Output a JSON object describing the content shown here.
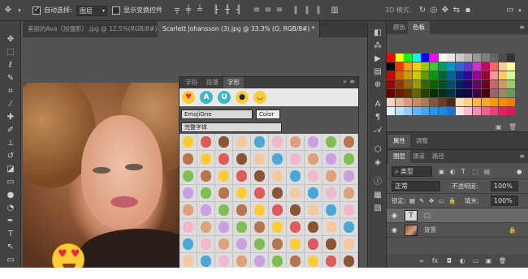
{
  "options_bar": {
    "auto_select_label": "自动选择:",
    "auto_select_value": "图层",
    "show_transform_label": "显示变换控件",
    "mode_3d_label": "3D 模式:"
  },
  "tabs": [
    {
      "label": "美丽的Ava（加强影）.jpg @ 12.5%(RGB/8#)",
      "active": false
    },
    {
      "label": "Scarlett Johansson (3).jpg @ 33.3% (O, RGB/8#) *",
      "active": true
    }
  ],
  "glyph_panel": {
    "tabs": [
      "字符",
      "段落",
      "字形"
    ],
    "active_tab": "字形",
    "font_family": "EmojiOne",
    "font_style": "Color",
    "filter": "完整字体",
    "recent": [
      {
        "symbol": "A",
        "color": "#3fb6c9"
      },
      {
        "symbol": "U",
        "color": "#3fb6c9"
      }
    ]
  },
  "swatches_panel": {
    "tabs": [
      "颜色",
      "色板"
    ],
    "active_tab": "色板"
  },
  "properties_panel": {
    "tabs": [
      "属性",
      "调整"
    ],
    "active_tab": "属性"
  },
  "layers_panel": {
    "tabs": [
      "图层",
      "通道",
      "路径"
    ],
    "active_tab": "图层",
    "filter_label": "类型",
    "blend_mode": "正常",
    "opacity_label": "不透明度:",
    "opacity": "100%",
    "lock_label": "锁定:",
    "fill_label": "填充:",
    "fill": "100%",
    "layers": [
      {
        "name": "□",
        "kind": "text",
        "visible": true,
        "selected": true
      },
      {
        "name": "背景",
        "kind": "image",
        "visible": true,
        "selected": false
      }
    ]
  }
}
